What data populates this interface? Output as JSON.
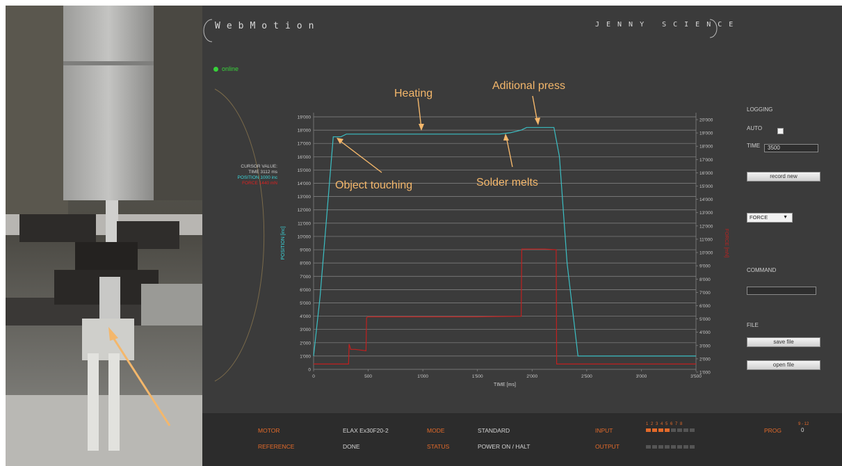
{
  "header": {
    "app_title": "WebMotion",
    "brand": "JENNY SCIENCE"
  },
  "status": {
    "online": "online"
  },
  "cursor": {
    "heading": "CURSOR VALUE:",
    "time": "TIME 3112 ms",
    "position": "POSITION 1000 inc",
    "force": "FORCE 1440 mN"
  },
  "sidebar": {
    "logging": "LOGGING",
    "auto": "AUTO",
    "time_label": "TIME",
    "time_value": "3500",
    "record_button": "record new",
    "select_value": "FORCE",
    "command": "COMMAND",
    "file": "FILE",
    "save_button": "save file",
    "open_button": "open file"
  },
  "annotations": {
    "heating": "Heating",
    "additional_press": "Aditional press",
    "object_touching": "Object touching",
    "solder_melts": "Solder melts"
  },
  "chart_data": {
    "type": "line",
    "xlabel": "TIME [ms]",
    "ylabel_left": "POSITION [inc]",
    "ylabel_right": "FORCE [mN]",
    "xlim": [
      0,
      3500
    ],
    "ylim_left": [
      0,
      19000
    ],
    "ylim_right": [
      1000,
      20000
    ],
    "x_ticks": [
      "0",
      "500",
      "1'000",
      "1'500",
      "2'000",
      "2'500",
      "3'000",
      "3'500"
    ],
    "y_ticks_left": [
      "0",
      "1'000",
      "2'000",
      "3'000",
      "4'000",
      "5'000",
      "6'000",
      "7'000",
      "8'000",
      "9'000",
      "10'000",
      "11'000",
      "12'000",
      "13'000",
      "14'000",
      "15'000",
      "16'000",
      "17'000",
      "18'000",
      "19'000"
    ],
    "y_ticks_right": [
      "1'000",
      "2'000",
      "3'000",
      "4'000",
      "5'000",
      "6'000",
      "7'000",
      "8'000",
      "9'000",
      "10'000",
      "11'000",
      "12'000",
      "13'000",
      "14'000",
      "15'000",
      "16'000",
      "17'000",
      "18'000",
      "19'000",
      "20'000"
    ],
    "grid": true,
    "series": [
      {
        "color": "#3bbfc4",
        "axis": "left",
        "x": [
          0,
          60,
          180,
          250,
          300,
          1000,
          1700,
          1800,
          1900,
          1950,
          2200,
          2250,
          2320,
          2420,
          2500,
          3500
        ],
        "y": [
          1000,
          5500,
          17500,
          17500,
          17700,
          17700,
          17700,
          17800,
          18000,
          18200,
          18200,
          16000,
          8000,
          1000,
          1000,
          1000
        ]
      },
      {
        "color": "#c0201f",
        "axis": "right",
        "x": [
          0,
          320,
          325,
          340,
          380,
          480,
          485,
          500,
          1500,
          1900,
          1905,
          1930,
          2000,
          2120,
          2220,
          2225,
          3500
        ],
        "y": [
          1400,
          1400,
          2900,
          2500,
          2500,
          2400,
          4900,
          4950,
          4950,
          5000,
          10050,
          10050,
          10050,
          10050,
          10000,
          1400,
          1400
        ]
      }
    ]
  },
  "footer": {
    "motor_label": "MOTOR",
    "motor_value": "ELAX Ex30F20-2",
    "mode_label": "MODE",
    "mode_value": "STANDARD",
    "input_label": "INPUT",
    "input_numbers": "1 2 3 4 5 6 7 8",
    "prog_label": "PROG",
    "prog_range": "9 - 12",
    "prog_value": "0",
    "reference_label": "REFERENCE",
    "reference_value": "DONE",
    "status_label": "STATUS",
    "status_value": "POWER ON / HALT",
    "output_label": "OUTPUT",
    "input_states": [
      1,
      1,
      1,
      1,
      0,
      0,
      0,
      0
    ],
    "output_states": [
      0,
      0,
      0,
      0,
      0,
      0,
      0,
      0
    ],
    "on_color": "#e36a2a",
    "off_color": "#555555"
  }
}
